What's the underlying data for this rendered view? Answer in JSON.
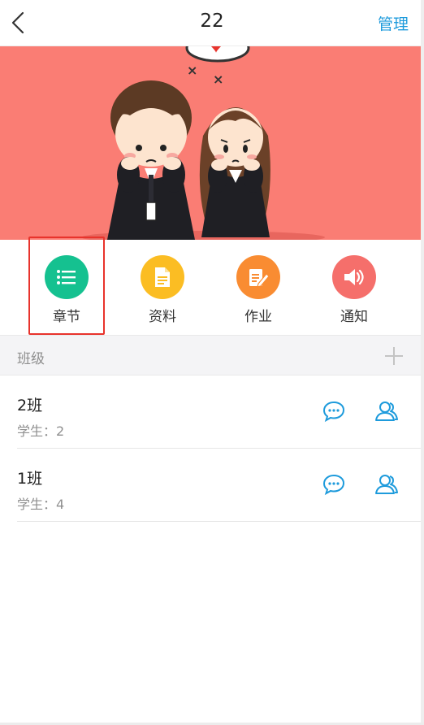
{
  "nav": {
    "title": "22",
    "manage_label": "管理",
    "back_icon": "chevron-left-icon"
  },
  "banner": {
    "background_color": "#fa7d74",
    "description": "cartoon couple illustration"
  },
  "features": [
    {
      "label": "章节",
      "icon": "list-icon",
      "color": "#15c190",
      "highlighted": true
    },
    {
      "label": "资料",
      "icon": "document-icon",
      "color": "#fbbd23",
      "highlighted": false
    },
    {
      "label": "作业",
      "icon": "edit-note-icon",
      "color": "#f98c32",
      "highlighted": false
    },
    {
      "label": "通知",
      "icon": "speaker-icon",
      "color": "#f56f6b",
      "highlighted": false
    }
  ],
  "section": {
    "title": "班级",
    "add_icon": "plus-icon"
  },
  "classes": [
    {
      "name": "2班",
      "students": "学生：2"
    },
    {
      "name": "1班",
      "students": "学生：4"
    }
  ],
  "colors": {
    "accent": "#1e9bdc",
    "highlight_border": "#e8332c"
  }
}
